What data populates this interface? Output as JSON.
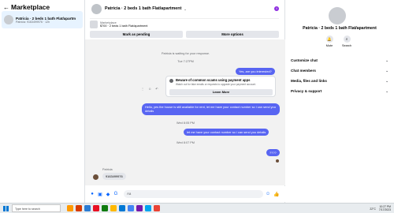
{
  "left": {
    "back_icon": "←",
    "title": "Marketplace",
    "conversation": {
      "name": "Patricia · 2 beds 1 bath Flat/apartm",
      "sub": "Patricia: 9163499976 · 12h"
    }
  },
  "chat": {
    "title": "Patricia · 2 beds 1 bath Flat/apartment",
    "chevron": "⌄",
    "info_icon": "i",
    "listing_label": "Marketplace",
    "listing_price": "$700 · 2 beds 1 bath Flat/apartment",
    "mark_pending": "Mark as pending",
    "more_options": "More options",
    "system_waiting": "Patricia is waiting for your response.",
    "time1": "Tue 7:27PM",
    "msg_interested": "Yes, are you interested?",
    "scam": {
      "title": "Beware of common scams using payment apps",
      "desc": "Watch out for fake emails or requests to upgrade your payment account.",
      "learn_more": "Learn More"
    },
    "react_icons": "⋮ ☺ ↶",
    "msg_available": "Hello, yes the house is still available for rent, let me have your contact number so i can send you details",
    "time2": "Wed 8:05 PM",
    "msg_contact": "let me have your contact number so i can send you details",
    "time3": "Wed 8:07 PM",
    "msg_question": "????",
    "sender": "Patricia",
    "msg_phone": "9163499976",
    "input_placeholder": "Aa",
    "icons": {
      "mic": "●",
      "photo": "▣",
      "sticker": "◆",
      "gif": "G",
      "emoji": "☺",
      "like": "👍"
    }
  },
  "right": {
    "title": "Patricia · 2 beds 1 bath Flat/apartment",
    "mute_label": "Mute",
    "search_label": "Search",
    "sections": [
      "Customize chat",
      "Chat members",
      "Media, files and links",
      "Privacy & support"
    ],
    "chevron": "⌄"
  },
  "taskbar": {
    "search_text": "Type here to search",
    "weather": "22°C",
    "time": "10:27 PM",
    "date": "7/17/2023"
  },
  "colors": {
    "accent": "#0866ff",
    "bubble": "#5865f2",
    "info": "#8e2ee0"
  }
}
